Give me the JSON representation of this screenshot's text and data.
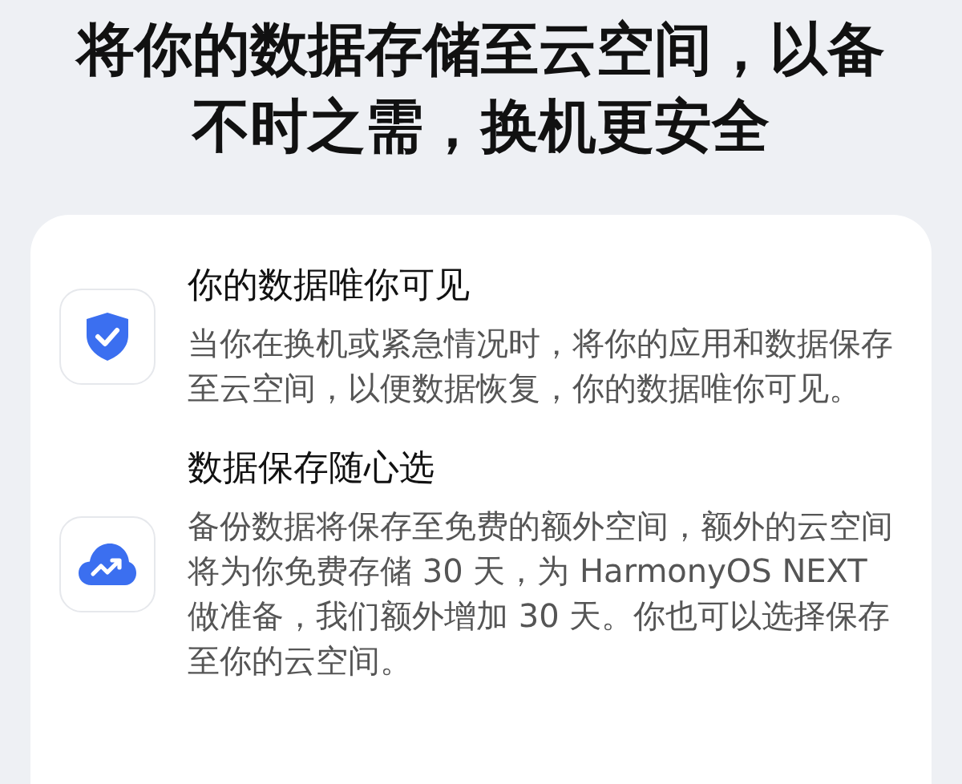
{
  "heading": "将你的数据存储至云空间，以备不时之需，换机更安全",
  "features": [
    {
      "kind": "shield",
      "title": "你的数据唯你可见",
      "description": "当你在换机或紧急情况时，将你的应用和数据保存至云空间，以便数据恢复，你的数据唯你可见。"
    },
    {
      "kind": "cloud",
      "title": "数据保存随心选",
      "description": "备份数据将保存至免费的额外空间，额外的云空间将为你免费存储 30 天，为 HarmonyOS NEXT 做准备，我们额外增加 30 天。你也可以选择保存至你的云空间。"
    }
  ]
}
